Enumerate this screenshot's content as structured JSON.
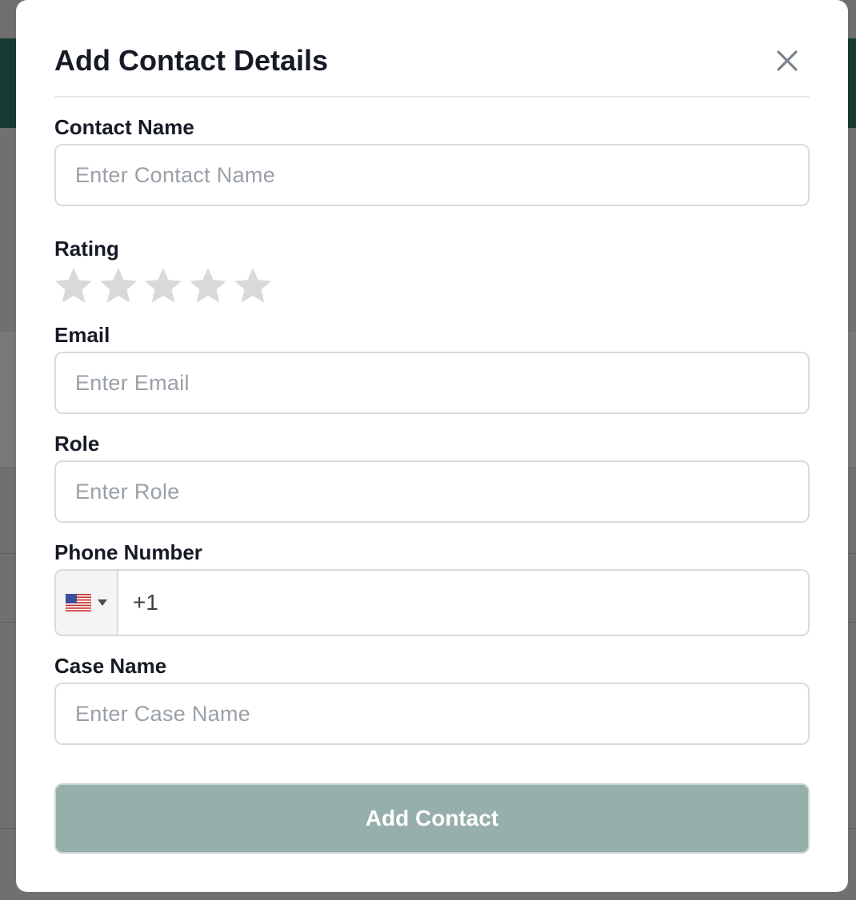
{
  "modal": {
    "title": "Add Contact Details"
  },
  "form": {
    "contact_name": {
      "label": "Contact Name",
      "placeholder": "Enter Contact Name",
      "value": ""
    },
    "rating": {
      "label": "Rating",
      "value": 0,
      "max": 5
    },
    "email": {
      "label": "Email",
      "placeholder": "Enter Email",
      "value": ""
    },
    "role": {
      "label": "Role",
      "placeholder": "Enter Role",
      "value": ""
    },
    "phone": {
      "label": "Phone Number",
      "country": "us-flag-icon",
      "value": "+1"
    },
    "case_name": {
      "label": "Case Name",
      "placeholder": "Enter Case Name",
      "value": ""
    },
    "submit_label": "Add Contact"
  },
  "colors": {
    "accent": "#96afab",
    "star_empty": "#d9d9d9",
    "header_bg": "#173a32",
    "text": "#161a25",
    "placeholder": "#9aa0a7"
  }
}
